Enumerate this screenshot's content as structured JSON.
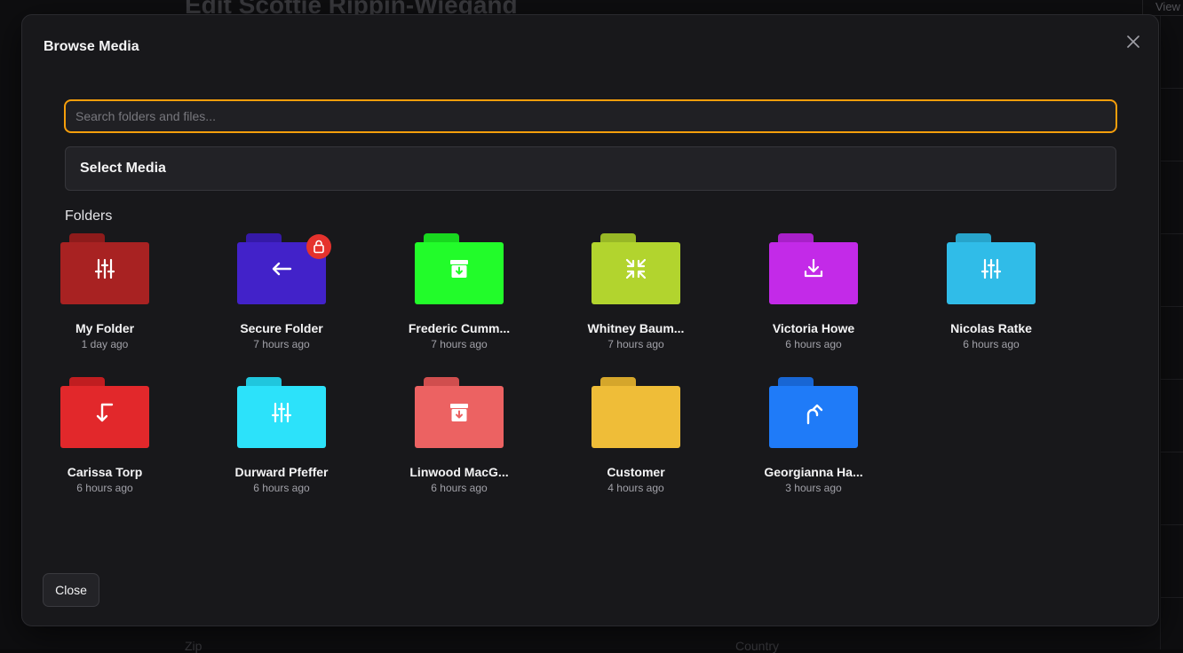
{
  "background": {
    "page_title": "Edit Scottie Rippin-Wiegand",
    "view_label": "View",
    "zip_label": "Zip",
    "country_label": "Country"
  },
  "modal": {
    "title": "Browse Media",
    "search_placeholder": "Search folders and files...",
    "search_value": "",
    "select_media_label": "Select Media",
    "folders_label": "Folders",
    "close_label": "Close",
    "accent_color": "#f59e0b"
  },
  "folders": [
    {
      "name": "My Folder",
      "time": "1 day ago",
      "color": "#a82222",
      "tab_color": "#8e1b1b",
      "icon": "sliders-icon",
      "locked": false
    },
    {
      "name": "Secure Folder",
      "time": "7 hours ago",
      "color": "#4222c9",
      "tab_color": "#3519a8",
      "icon": "arrow-left-icon",
      "locked": true
    },
    {
      "name": "Frederic Cumm...",
      "time": "7 hours ago",
      "color": "#22fc2a",
      "tab_color": "#18d81f",
      "icon": "archive-icon",
      "locked": false
    },
    {
      "name": "Whitney Baum...",
      "time": "7 hours ago",
      "color": "#b2d42e",
      "tab_color": "#98b826",
      "icon": "shrink-icon",
      "locked": false
    },
    {
      "name": "Victoria Howe",
      "time": "6 hours ago",
      "color": "#c32ae8",
      "tab_color": "#a820c9",
      "icon": "download-icon",
      "locked": false
    },
    {
      "name": "Nicolas Ratke",
      "time": "6 hours ago",
      "color": "#30bce8",
      "tab_color": "#27a4cb",
      "icon": "sliders-icon",
      "locked": false
    },
    {
      "name": "Carissa Torp",
      "time": "6 hours ago",
      "color": "#e2282b",
      "tab_color": "#c01d20",
      "icon": "corner-down-left-icon",
      "locked": false
    },
    {
      "name": "Durward Pfeffer",
      "time": "6 hours ago",
      "color": "#2ce2fa",
      "tab_color": "#20c6dd",
      "icon": "sliders-icon",
      "locked": false
    },
    {
      "name": "Linwood MacG...",
      "time": "6 hours ago",
      "color": "#ec6262",
      "tab_color": "#d04e4e",
      "icon": "archive-icon",
      "locked": false
    },
    {
      "name": "Customer",
      "time": "4 hours ago",
      "color": "#efbd38",
      "tab_color": "#d5a62b",
      "icon": "none",
      "locked": false
    },
    {
      "name": "Georgianna Ha...",
      "time": "3 hours ago",
      "color": "#1f7bf8",
      "tab_color": "#1866d4",
      "icon": "undo-arrow-icon",
      "locked": false
    }
  ]
}
